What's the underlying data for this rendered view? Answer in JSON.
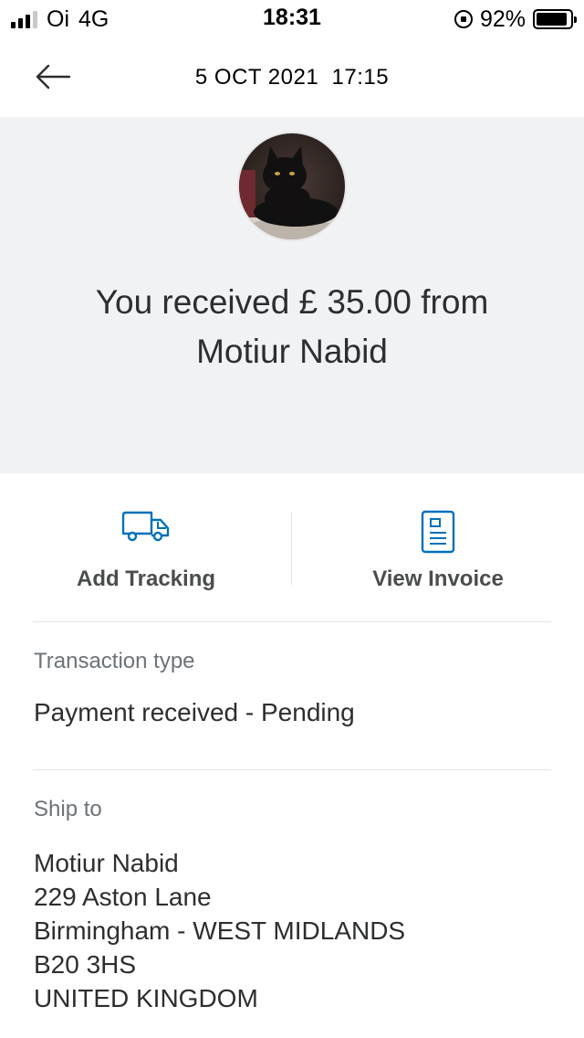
{
  "status_bar": {
    "carrier": "Oi",
    "network": "4G",
    "time": "18:31",
    "battery": "92%",
    "battery_level": 0.92
  },
  "header": {
    "back_icon": "arrow-left-icon",
    "date": "5 OCT 2021",
    "time": "17:15"
  },
  "hero": {
    "headline_line1": "You received £ 35.00 from",
    "headline_line2": "Motiur Nabid"
  },
  "actions": {
    "add_tracking": {
      "label": "Add Tracking",
      "icon": "truck-icon"
    },
    "view_invoice": {
      "label": "View Invoice",
      "icon": "invoice-icon"
    }
  },
  "transaction": {
    "label": "Transaction type",
    "value": "Payment received - Pending"
  },
  "ship_to": {
    "label": "Ship to",
    "lines": [
      "Motiur Nabid",
      "229 Aston Lane",
      "Birmingham - WEST MIDLANDS",
      "B20 3HS",
      "UNITED KINGDOM"
    ]
  },
  "colors": {
    "accent_blue": "#0070ba",
    "hero_bg": "#f1f2f4",
    "text_primary": "#2c2e2f",
    "text_secondary": "#6c7378"
  }
}
